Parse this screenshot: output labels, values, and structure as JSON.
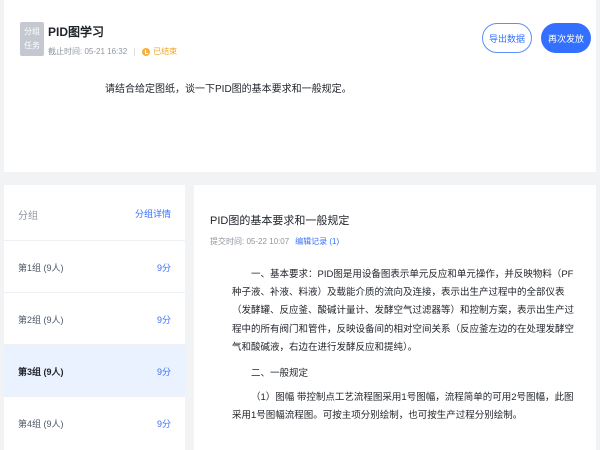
{
  "task": {
    "icon_text": "分组\n任务",
    "title": "PID图学习",
    "deadline": "截止时间: 05-21 16:32",
    "status": "已结束",
    "export_label": "导出数据",
    "resend_label": "再次发放",
    "prompt": "请结合给定图纸，谈一下PID图的基本要求和一般规定。"
  },
  "groups": {
    "header": "分组",
    "detail_link": "分组详情",
    "items": [
      {
        "name": "第1组 (9人)",
        "score": "9分"
      },
      {
        "name": "第2组 (9人)",
        "score": "9分"
      },
      {
        "name": "第3组 (9人)",
        "score": "9分"
      },
      {
        "name": "第4组 (9人)",
        "score": "9分"
      }
    ]
  },
  "answer": {
    "title": "PID图的基本要求和一般规定",
    "submitted": "提交时间: 05-22 10:07",
    "edit_record": "编辑记录 (1)",
    "para1": "一、基本要求：PID图是用设备图表示单元反应和单元操作，并反映物料（PF种子液、补液、料液）及载能介质的流向及连接，表示出生产过程中的全部仪表（发酵罐、反应釜、酸碱计量计、发酵空气过滤器等）和控制方案，表示出生产过程中的所有阀门和管件，反映设备间的相对空间关系（反应釜左边的在处理发酵空气和酸碱液，右边在进行发酵反应和提纯）。",
    "para2": "二、一般规定",
    "para3": "（1）图幅 带控制点工艺流程图采用1号图幅，流程简单的可用2号图幅，此图采用1号图幅流程图。可按主项分别绘制，也可按生产过程分别绘制。"
  },
  "colors": {
    "accent": "#3370ff",
    "status": "#f5a623",
    "active_row": "#eaf1ff"
  }
}
